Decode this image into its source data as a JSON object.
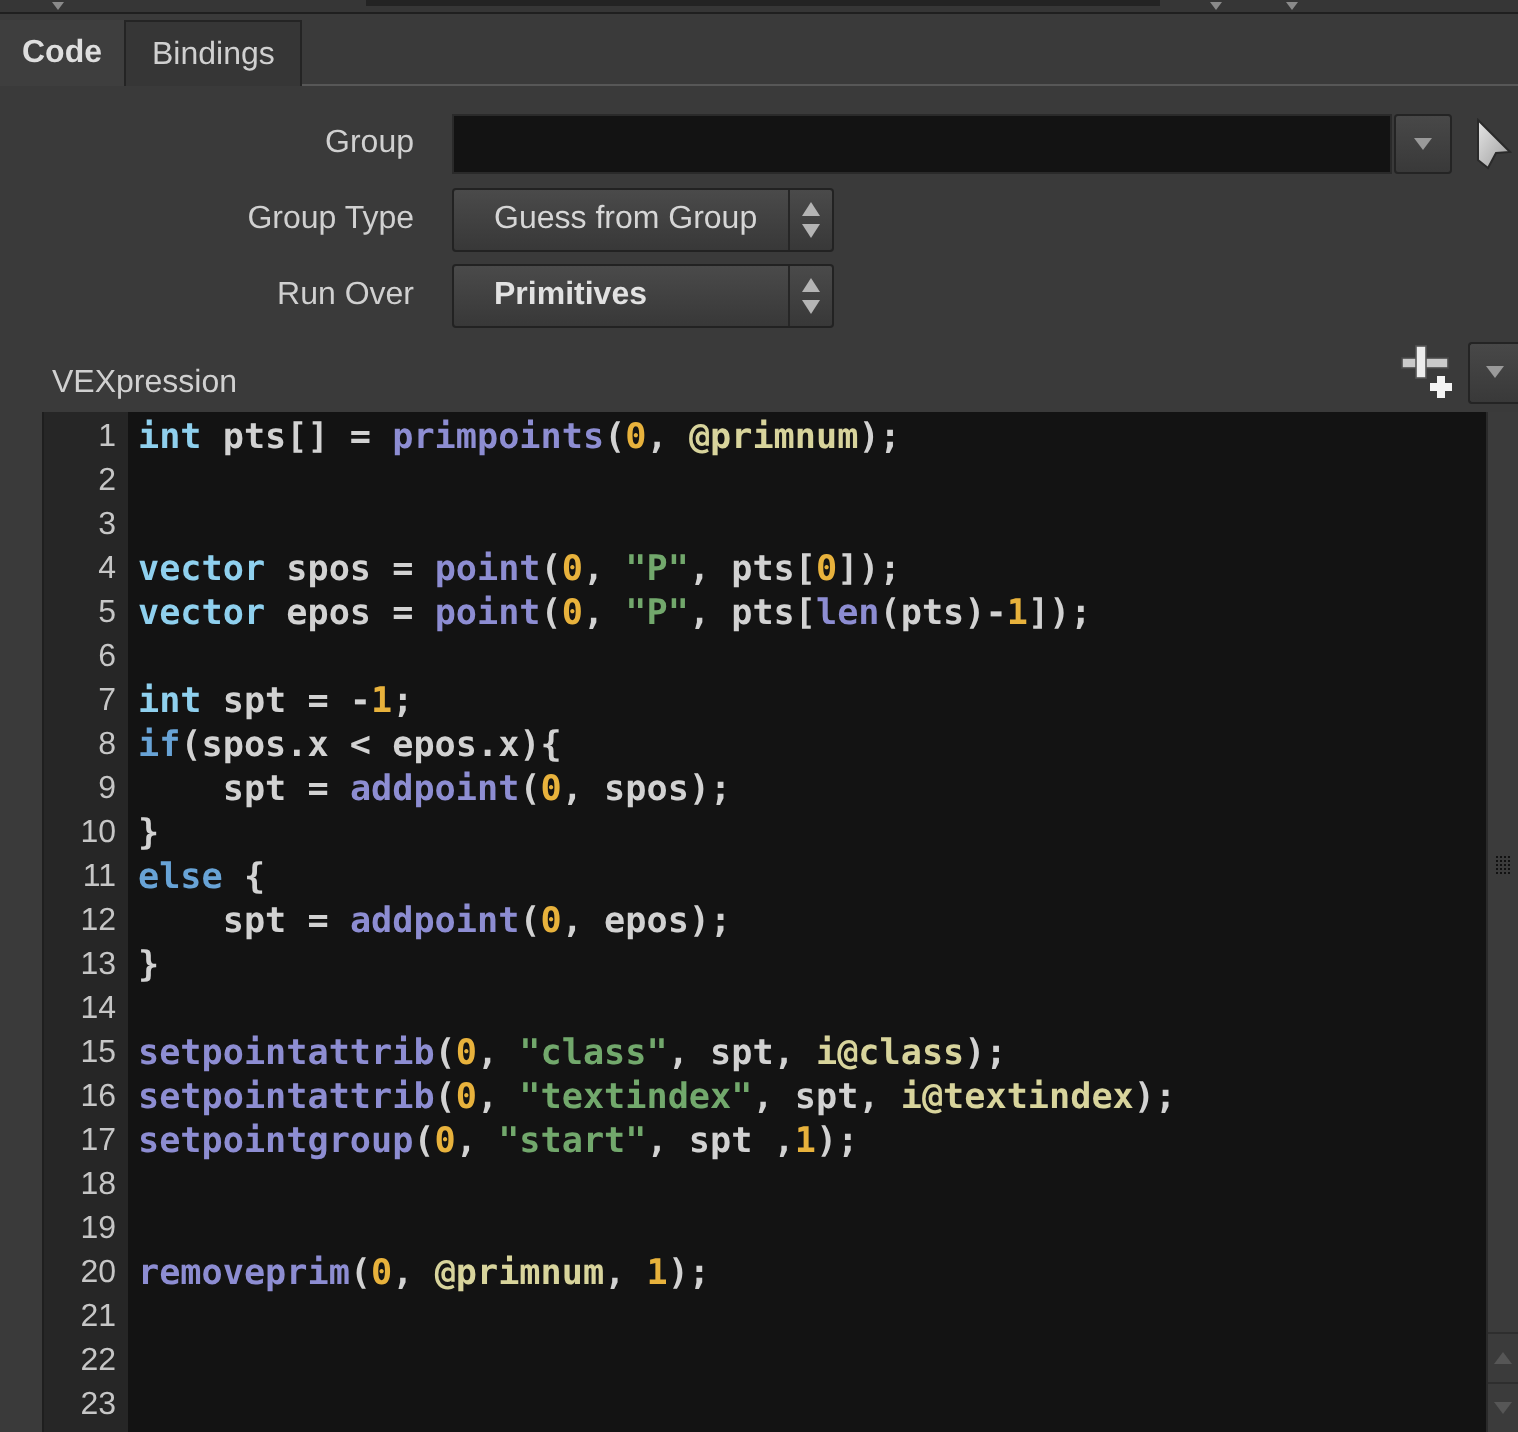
{
  "tabs": [
    {
      "label": "Code",
      "selected": true
    },
    {
      "label": "Bindings",
      "selected": false
    }
  ],
  "fields": [
    {
      "kind": "text",
      "label": "Group"
    },
    {
      "kind": "menu",
      "label": "Group Type",
      "value": "Guess from Group",
      "changed": false
    },
    {
      "kind": "menu",
      "label": "Run Over",
      "value": "Primitives",
      "changed": true
    }
  ],
  "editor": {
    "label": "VEXpression",
    "lines": [
      {
        "number": "1",
        "tokens": [
          {
            "kind": "type",
            "text": "int"
          },
          {
            "kind": "plain",
            "text": " pts[] = "
          },
          {
            "kind": "function",
            "text": "primpoints"
          },
          {
            "kind": "plain",
            "text": "("
          },
          {
            "kind": "number",
            "text": "0"
          },
          {
            "kind": "plain",
            "text": ", "
          },
          {
            "kind": "attribute",
            "text": "@primnum"
          },
          {
            "kind": "plain",
            "text": ");"
          }
        ]
      },
      {
        "number": "2"
      },
      {
        "number": "3"
      },
      {
        "number": "4",
        "tokens": [
          {
            "kind": "type",
            "text": "vector"
          },
          {
            "kind": "plain",
            "text": " spos = "
          },
          {
            "kind": "function",
            "text": "point"
          },
          {
            "kind": "plain",
            "text": "("
          },
          {
            "kind": "number",
            "text": "0"
          },
          {
            "kind": "plain",
            "text": ", "
          },
          {
            "kind": "string",
            "text": "\"P\""
          },
          {
            "kind": "plain",
            "text": ", pts["
          },
          {
            "kind": "number",
            "text": "0"
          },
          {
            "kind": "plain",
            "text": "]);"
          }
        ]
      },
      {
        "number": "5",
        "tokens": [
          {
            "kind": "type",
            "text": "vector"
          },
          {
            "kind": "plain",
            "text": " epos = "
          },
          {
            "kind": "function",
            "text": "point"
          },
          {
            "kind": "plain",
            "text": "("
          },
          {
            "kind": "number",
            "text": "0"
          },
          {
            "kind": "plain",
            "text": ", "
          },
          {
            "kind": "string",
            "text": "\"P\""
          },
          {
            "kind": "plain",
            "text": ", pts["
          },
          {
            "kind": "function",
            "text": "len"
          },
          {
            "kind": "plain",
            "text": "(pts)-"
          },
          {
            "kind": "number",
            "text": "1"
          },
          {
            "kind": "plain",
            "text": "]);"
          }
        ]
      },
      {
        "number": "6"
      },
      {
        "number": "7",
        "tokens": [
          {
            "kind": "type",
            "text": "int"
          },
          {
            "kind": "plain",
            "text": " spt = -"
          },
          {
            "kind": "number",
            "text": "1"
          },
          {
            "kind": "plain",
            "text": ";"
          }
        ]
      },
      {
        "number": "8",
        "tokens": [
          {
            "kind": "keyword",
            "text": "if"
          },
          {
            "kind": "plain",
            "text": "(spos.x < epos.x){"
          }
        ]
      },
      {
        "number": "9",
        "tokens": [
          {
            "kind": "plain",
            "text": "    spt = "
          },
          {
            "kind": "function",
            "text": "addpoint"
          },
          {
            "kind": "plain",
            "text": "("
          },
          {
            "kind": "number",
            "text": "0"
          },
          {
            "kind": "plain",
            "text": ", spos);"
          }
        ]
      },
      {
        "number": "10",
        "tokens": [
          {
            "kind": "plain",
            "text": "}"
          }
        ]
      },
      {
        "number": "11",
        "tokens": [
          {
            "kind": "keyword",
            "text": "else"
          },
          {
            "kind": "plain",
            "text": " {"
          }
        ]
      },
      {
        "number": "12",
        "tokens": [
          {
            "kind": "plain",
            "text": "    spt = "
          },
          {
            "kind": "function",
            "text": "addpoint"
          },
          {
            "kind": "plain",
            "text": "("
          },
          {
            "kind": "number",
            "text": "0"
          },
          {
            "kind": "plain",
            "text": ", epos);"
          }
        ]
      },
      {
        "number": "13",
        "tokens": [
          {
            "kind": "plain",
            "text": "}"
          }
        ]
      },
      {
        "number": "14"
      },
      {
        "number": "15",
        "tokens": [
          {
            "kind": "function",
            "text": "setpointattrib"
          },
          {
            "kind": "plain",
            "text": "("
          },
          {
            "kind": "number",
            "text": "0"
          },
          {
            "kind": "plain",
            "text": ", "
          },
          {
            "kind": "string",
            "text": "\"class\""
          },
          {
            "kind": "plain",
            "text": ", spt, "
          },
          {
            "kind": "attribute",
            "text": "i@class"
          },
          {
            "kind": "plain",
            "text": ");"
          }
        ]
      },
      {
        "number": "16",
        "tokens": [
          {
            "kind": "function",
            "text": "setpointattrib"
          },
          {
            "kind": "plain",
            "text": "("
          },
          {
            "kind": "number",
            "text": "0"
          },
          {
            "kind": "plain",
            "text": ", "
          },
          {
            "kind": "string",
            "text": "\"textindex\""
          },
          {
            "kind": "plain",
            "text": ", spt, "
          },
          {
            "kind": "attribute",
            "text": "i@textindex"
          },
          {
            "kind": "plain",
            "text": ");"
          }
        ]
      },
      {
        "number": "17",
        "tokens": [
          {
            "kind": "function",
            "text": "setpointgroup"
          },
          {
            "kind": "plain",
            "text": "("
          },
          {
            "kind": "number",
            "text": "0"
          },
          {
            "kind": "plain",
            "text": ", "
          },
          {
            "kind": "string",
            "text": "\"start\""
          },
          {
            "kind": "plain",
            "text": ", spt ,"
          },
          {
            "kind": "number",
            "text": "1"
          },
          {
            "kind": "plain",
            "text": ");"
          }
        ]
      },
      {
        "number": "18"
      },
      {
        "number": "19"
      },
      {
        "number": "20",
        "tokens": [
          {
            "kind": "function",
            "text": "removeprim"
          },
          {
            "kind": "plain",
            "text": "("
          },
          {
            "kind": "number",
            "text": "0"
          },
          {
            "kind": "plain",
            "text": ", "
          },
          {
            "kind": "attribute",
            "text": "@primnum"
          },
          {
            "kind": "plain",
            "text": ", "
          },
          {
            "kind": "number",
            "text": "1"
          },
          {
            "kind": "plain",
            "text": ");"
          }
        ]
      },
      {
        "number": "21"
      },
      {
        "number": "22"
      },
      {
        "number": "23"
      }
    ]
  }
}
